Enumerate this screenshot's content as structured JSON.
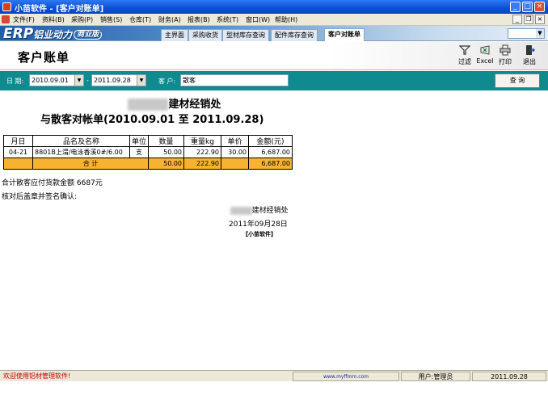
{
  "window": {
    "title": "小苗软件 - [客户对账单]"
  },
  "menu": [
    "文件(F)",
    "资料(B)",
    "采购(P)",
    "销售(S)",
    "仓库(T)",
    "财务(A)",
    "报表(B)",
    "系统(T)",
    "窗口(W)",
    "帮助(H)"
  ],
  "brand": {
    "erp": "ERP",
    "name": "铝业动力",
    "edition": "商业版"
  },
  "nav_tabs": [
    "主界面",
    "采购收货",
    "型材库存查询",
    "配件库存查询",
    "客户对账单"
  ],
  "page": {
    "title": "客户账单"
  },
  "toolbar": {
    "filter": "过滤",
    "excel": "Excel",
    "print": "打印",
    "exit": "退出"
  },
  "filters": {
    "date_label": "日 期:",
    "date_from": "2010.09.01",
    "date_sep": "-",
    "date_to": "2011.09.28",
    "customer_label": "客 户:",
    "customer": "散客",
    "query_button": "查 询"
  },
  "report": {
    "company_suffix": "建材经销处",
    "title": "与散客对帐单(2010.09.01 至 2011.09.28)",
    "columns": [
      "月日",
      "品名及名称",
      "单位",
      "数量",
      "重量kg",
      "单价",
      "金额(元)"
    ],
    "rows": [
      {
        "date": "04-21",
        "name": "8801B上渭/电泳香溪0#/6.00",
        "unit": "支",
        "qty": "50.00",
        "weight": "222.90",
        "price": "30.00",
        "amount": "6,687.00"
      }
    ],
    "total": {
      "label": "合 计",
      "qty": "50.00",
      "weight": "222.90",
      "amount": "6,687.00"
    },
    "summary": "合计散客应付货款金额 6687元",
    "confirm": "核对后盖章并签名确认:",
    "sign_company_suffix": "建材经销处",
    "sign_date": "2011年09月28日",
    "software": "【小苗软件】"
  },
  "status": {
    "welcome": "欢迎使用铝材管理软件!",
    "url": "www.myffmm.com",
    "user": "用户:管理员",
    "date": "2011.09.28"
  }
}
